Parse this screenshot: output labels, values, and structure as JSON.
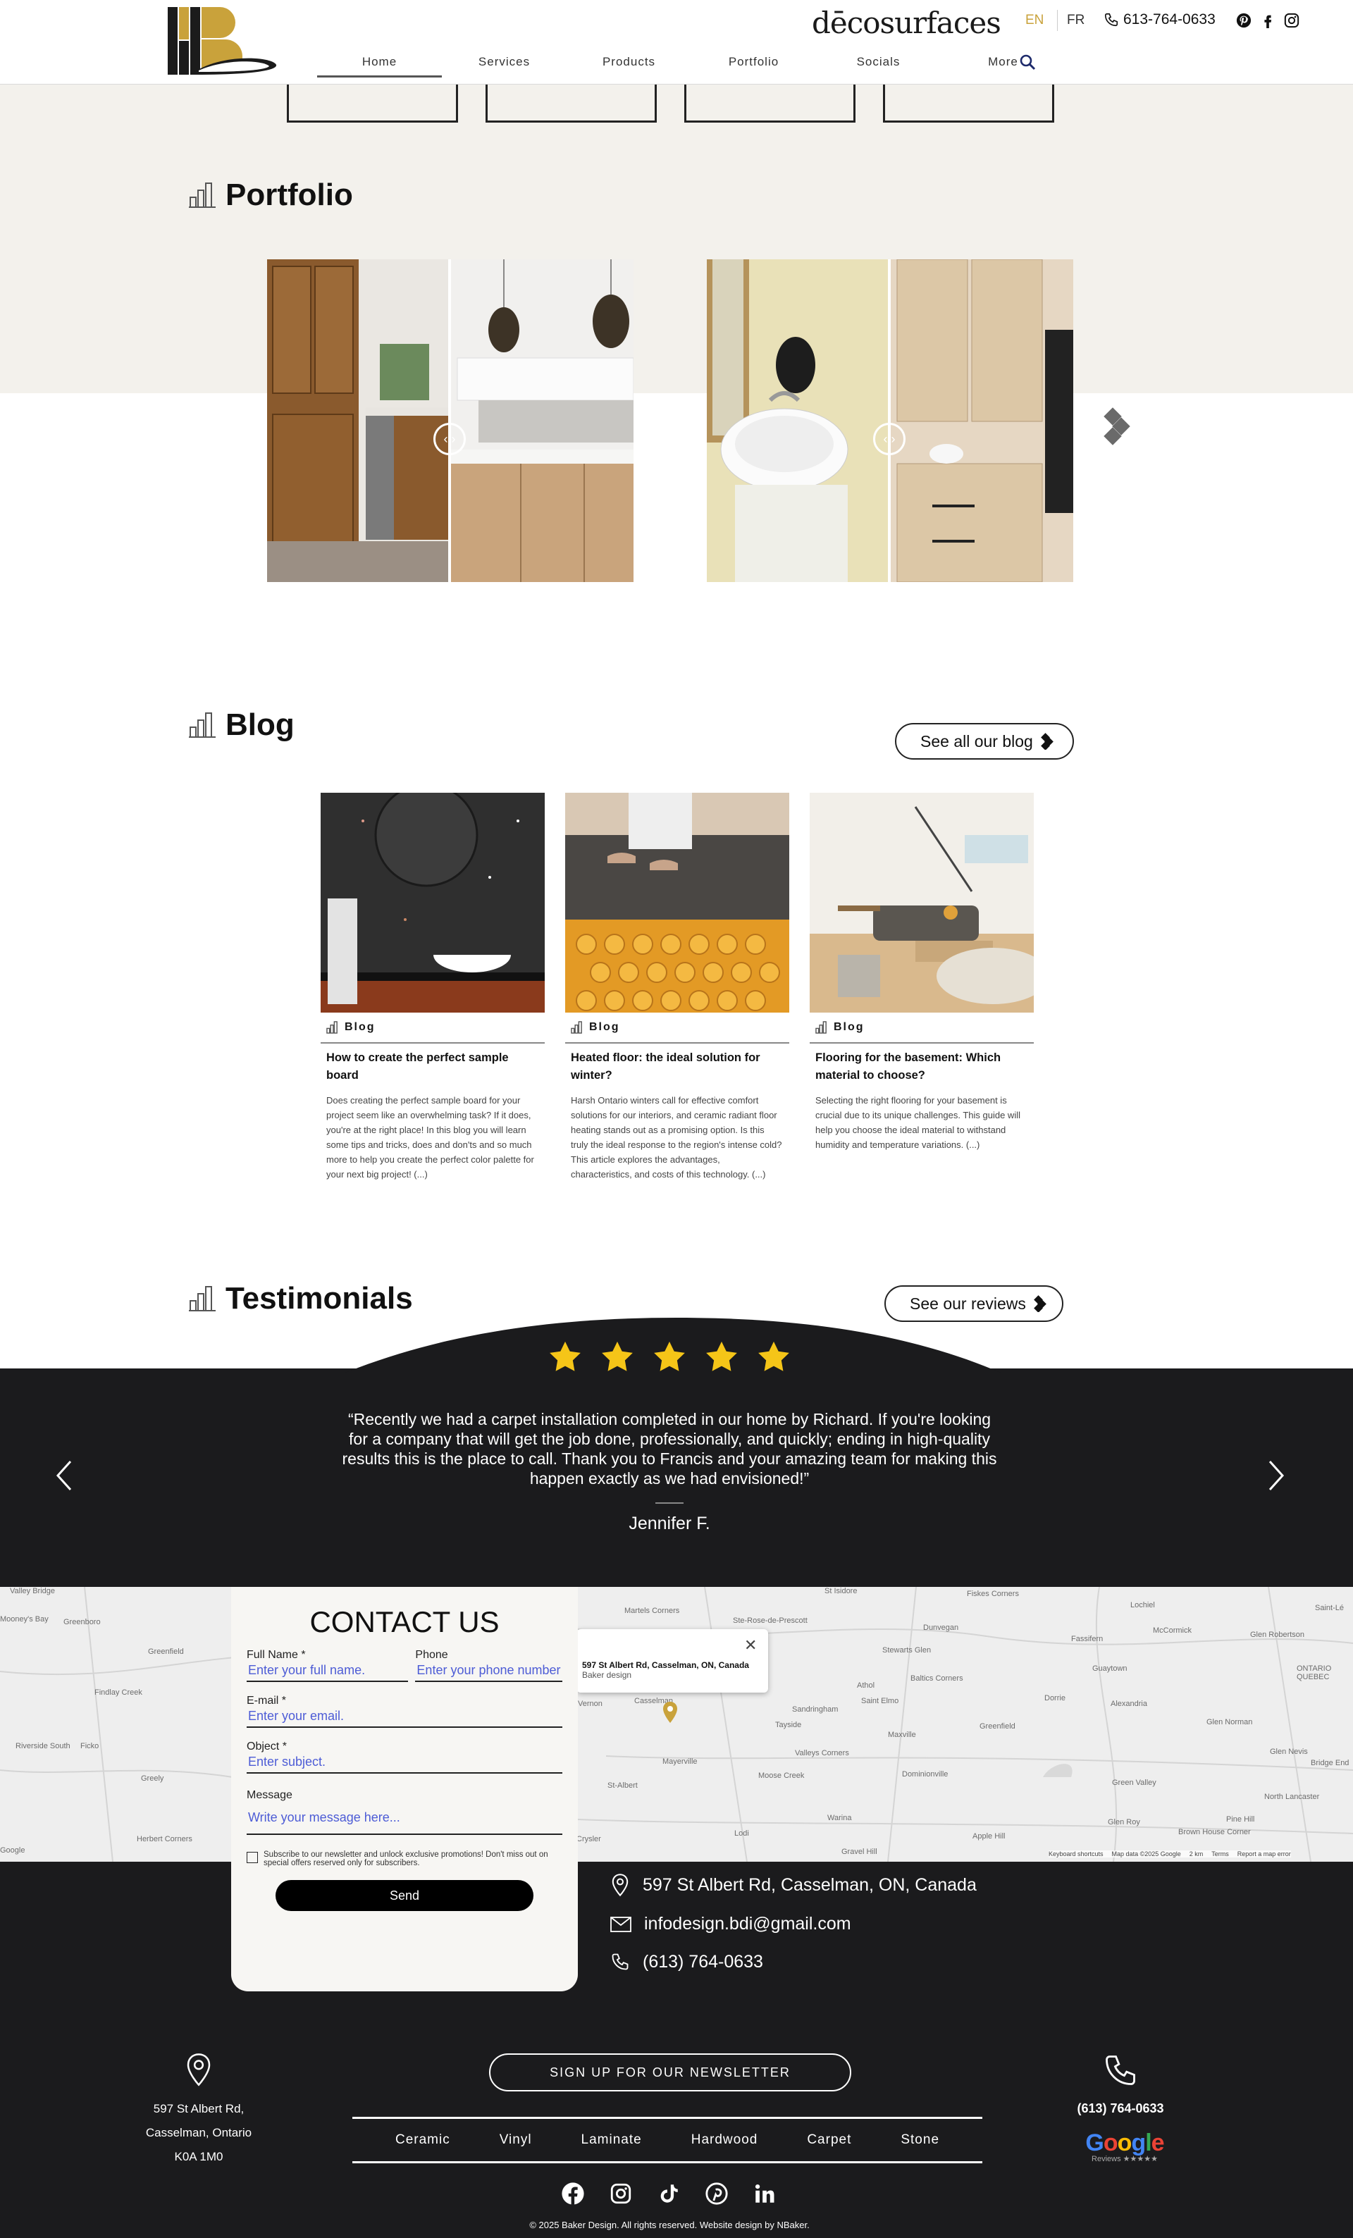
{
  "header": {
    "brand": "dēcosurfaces",
    "lang_en": "EN",
    "lang_fr": "FR",
    "phone": "613-764-0633",
    "nav": [
      "Home",
      "Services",
      "Products",
      "Portfolio",
      "Socials",
      "More"
    ]
  },
  "portfolio": {
    "title": "Portfolio"
  },
  "blog": {
    "title": "Blog",
    "see_all": "See all our blog",
    "posts": [
      {
        "category": "Blog",
        "title": "How to create the perfect sample board",
        "excerpt": "Does creating the perfect sample board for your project seem like an overwhelming task? If it does, you're at the right place! In this blog you will learn some tips and tricks, does and don'ts and so much more to help you create the perfect color palette for your next big project! (...)"
      },
      {
        "category": "Blog",
        "title": "Heated floor: the ideal solution for winter?",
        "excerpt": "Harsh Ontario winters call for effective comfort solutions for our interiors, and ceramic radiant floor heating stands out as a promising option. Is this truly the ideal response to the region's intense cold? This article explores the advantages, characteristics, and costs of this technology. (...)"
      },
      {
        "category": "Blog",
        "title": "Flooring for the basement: Which material to choose?",
        "excerpt": "Selecting the right flooring for your basement is crucial due to its unique challenges. This guide will help you choose the ideal material to withstand humidity and temperature variations. (...)"
      }
    ]
  },
  "testimonials": {
    "title": "Testimonials",
    "see_reviews": "See our reviews",
    "rating": 5,
    "quote": "“Recently we had a carpet installation completed in our home by Richard. If you're looking for a company that will get the job done, professionally, and quickly; ending in high-quality results this is the place to call. Thank you to Francis and your amazing team for making this happen exactly as we had envisioned!”",
    "author": "Jennifer F."
  },
  "map": {
    "popup_title": "597 St Albert Rd, Casselman, ON, Canada",
    "popup_sub": "Baker design",
    "attribution": [
      "Keyboard shortcuts",
      "Map data ©2025 Google",
      "2 km",
      "Terms",
      "Report a map error"
    ],
    "labels": [
      "Martels Corners",
      "Ste-Rose-de-Prescott",
      "Dunvegan",
      "Fassifern",
      "Stewarts Glen",
      "Baltics Corners",
      "Athol",
      "Sandringham",
      "Saint Elmo",
      "Tayside",
      "Maxville",
      "Greenfield",
      "Dominionville",
      "Valleys Corners",
      "Moose Creek",
      "Mayerville",
      "St-Albert",
      "Warina",
      "Apple Hill",
      "Lodi",
      "Gravel Hill",
      "Crysler",
      "Alexandria",
      "Glen Norman",
      "Glen Nevis",
      "Green Valley",
      "Glen Roy",
      "Pine Hill",
      "North Lancaster",
      "Brown House Corner",
      "Bridge End",
      "Lochiel",
      "McCormick",
      "Glen Robertson",
      "Guaytown",
      "Dorrie",
      "Saint-Lé",
      "ONTARIO QUEBEC",
      "Fiskes Corners",
      "St Isidore",
      "Findlay Creek",
      "Greenfield",
      "Ficko",
      "Greely",
      "Riverside South",
      "Herbert Corners",
      "Mooney's Bay",
      "Greenboro",
      "Valley Bridge",
      "Casselman",
      "Vernon",
      "Google"
    ]
  },
  "contact": {
    "title": "CONTACT US",
    "fullname_label": "Full Name *",
    "fullname_placeholder": "Enter your full name.",
    "phone_label": "Phone",
    "phone_placeholder": "Enter your phone number.",
    "email_label": "E-mail *",
    "email_placeholder": "Enter your email.",
    "object_label": "Object *",
    "object_placeholder": "Enter subject.",
    "message_label": "Message",
    "message_placeholder": "Write your message here...",
    "newsletter_check": "Subscribe to our newsletter and unlock exclusive promotions! Don't miss out on special offers reserved only for subscribers.",
    "send": "Send",
    "address": "597 St Albert Rd, Casselman, ON, Canada",
    "email": "infodesign.bdi@gmail.com",
    "phone": "(613) 764-0633"
  },
  "footer": {
    "address_lines": [
      "597 St Albert Rd,",
      "Casselman, Ontario",
      "K0A 1M0"
    ],
    "newsletter": "SIGN UP FOR OUR NEWSLETTER",
    "links": [
      "Ceramic",
      "Vinyl",
      "Laminate",
      "Hardwood",
      "Carpet",
      "Stone"
    ],
    "phone": "(613) 764-0633",
    "google": "Google",
    "google_reviews": "Reviews ★★★★★",
    "copyright": "© 2025 Baker Design. All rights reserved. Website design by NBaker."
  },
  "colors": {
    "accent_gold": "#c9a23b",
    "dark": "#1b1b1d",
    "beige": "#f3f1ec",
    "star": "#f5c518"
  }
}
